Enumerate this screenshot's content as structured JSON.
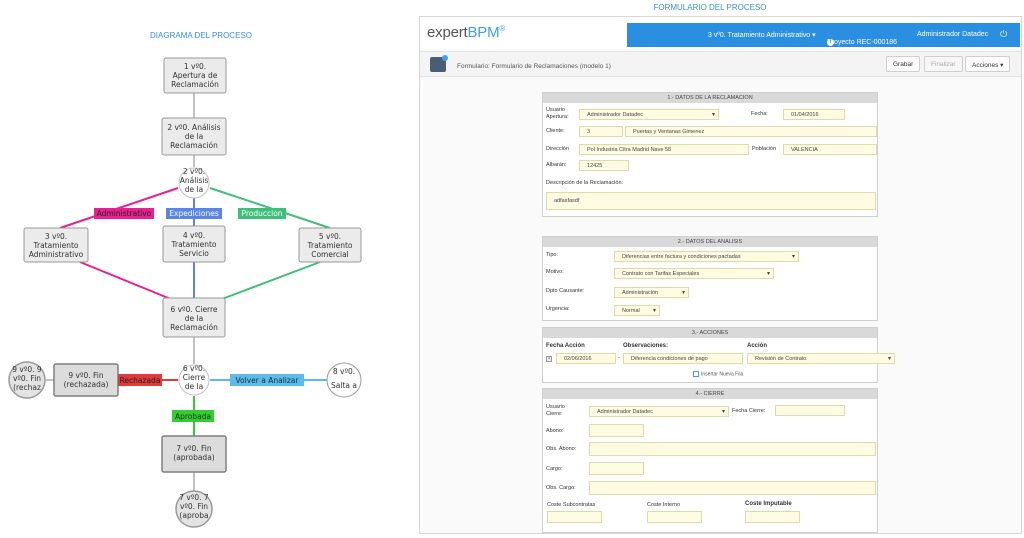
{
  "diagram": {
    "title": "DIAGRAMA DEL PROCESO",
    "nodes": {
      "apertura": [
        "1 vº0.",
        "Apertura de",
        "Reclamación"
      ],
      "analisis": [
        "2 vº0. Análisis",
        "de la",
        "Reclamación"
      ],
      "decision_analisis": [
        "2 vº0.",
        "Análisis",
        "de la"
      ],
      "administrativo": [
        "3 vº0.",
        "Tratamiento",
        "Administrativo"
      ],
      "servicio": [
        "4 vº0.",
        "Tratamiento",
        "Servicio"
      ],
      "comercial": [
        "5 vº0.",
        "Tratamiento",
        "Comercial"
      ],
      "cierre": [
        "6 vº0. Cierre",
        "de la",
        "Reclamación"
      ],
      "decision_cierre": [
        "6 vº0.",
        "Cierre",
        "de la"
      ],
      "fin_rechazada_partial": [
        "9 vº0. 9",
        "vº0. Fin",
        "(rechaz"
      ],
      "fin_rechazada": [
        "9 vº0. Fin",
        "(rechazada)"
      ],
      "salta": [
        "8 vº0.",
        "Salta a"
      ],
      "fin_aprobada": [
        "7 vº0. Fin",
        "(aprobada)"
      ],
      "fin_aprobada_partial": [
        "7 vº0. 7",
        "vº0. Fin",
        "(aproba"
      ]
    },
    "flows": {
      "administrativo": "Administrativo",
      "expediciones": "Expediciones",
      "produccion": "Produccion",
      "rechazada": "Rechazada",
      "volver": "Volver a Analizar",
      "aprobada": "Aprobada"
    },
    "colors": {
      "administrativo": "#e8218f",
      "expediciones": "#5b84e8",
      "produccion": "#3fbf7a",
      "rechazada": "#e03a3a",
      "volver": "#5bbcec",
      "aprobada": "#33cc33",
      "default": "#c2c2c2"
    }
  },
  "form": {
    "section_title": "FORMULARIO DEL PROCESO",
    "logo": {
      "expert": "expert",
      "bpm": "BPM",
      "mark": "®"
    },
    "nav": {
      "task": "3 vº0. Tratamiento Administrativo ▾",
      "project": "Proyecto REC-000186",
      "user": "Administrador Datadec"
    },
    "toolbar": {
      "title": "Formulario: Formulario de Reclamaciones (modelo 1)",
      "save": "Grabar",
      "finish": "Finalizar",
      "actions": "Acciones ▾"
    },
    "datos_reclamacion": {
      "header": "1.- DATOS DE LA RECLAMACION",
      "usuario_apertura_label_1": "Usuario",
      "usuario_apertura_label_2": "Apertura:",
      "usuario_apertura": "Administrador Datadec",
      "fecha_label": "Fecha:",
      "fecha": "01/04/2016",
      "cliente_label": "Cliente:",
      "cliente_codigo": "3",
      "cliente_nombre": "Puertas y Ventanas Gimenez",
      "direccion_label": "Dirección",
      "direccion": "Pol Industria Citra Madrid Nave 58",
      "poblacion_label": "Población",
      "poblacion": "VALENCIA",
      "albaran_label": "Albarán:",
      "albaran": "12425",
      "descripcion_label": "Descripción de la Reclamación:",
      "descripcion": "adfasfasdf"
    },
    "datos_analisis": {
      "header": "2.- DATOS DEL ANALISIS",
      "tipo_label": "Tipo:",
      "tipo": "Diferencias entre factura y condiciones pactadas",
      "motivo_label": "Motivo:",
      "motivo": "Contrato con Tarifas Especiales",
      "dpto_label": "Dpto Causante:",
      "dpto": "Administración",
      "urgencia_label": "Urgencia:",
      "urgencia": "Normal"
    },
    "acciones": {
      "header": "3.- ACCIONES",
      "col_fecha": "Fecha Acción",
      "col_obs": "Observaciones:",
      "col_accion": "Acción",
      "row_fecha": "02/06/2016",
      "row_obs": "Diferencia condiciones de pago",
      "row_accion": "Revisión de Contrato",
      "insert_row": "Insertar Nueva Fila"
    },
    "cierre": {
      "header": "4.- CIERRE",
      "usuario_cierre_label_1": "Usuario",
      "usuario_cierre_label_2": "Cierre:",
      "usuario_cierre": "Administrador Datadec",
      "fecha_cierre_label": "Fecha Cierre:",
      "abono_label": "Abono:",
      "obs_abono_label": "Obs. Abono:",
      "cargo_label": "Cargo:",
      "obs_cargo_label": "Obs. Cargo:",
      "coste_subcontratas_label": "Coste Subcontratas",
      "coste_interno_label": "Coste Interno",
      "coste_imputable_label": "Coste Imputable"
    }
  }
}
